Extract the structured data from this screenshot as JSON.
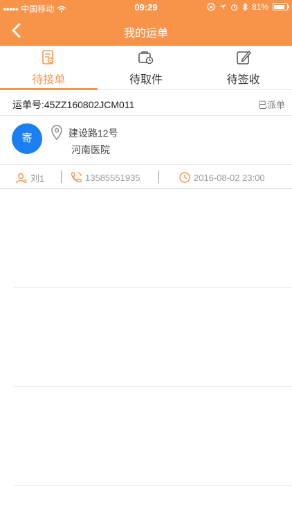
{
  "status_bar": {
    "signal_dots": "●●●●●",
    "carrier": "中国移动",
    "time": "09:29",
    "battery_percent": "81%",
    "battery_level": 0.81
  },
  "navbar": {
    "title": "我的运单"
  },
  "tabs": [
    {
      "label": "待接单",
      "active": true,
      "icon": "list-doc-icon"
    },
    {
      "label": "待取件",
      "active": false,
      "icon": "package-clock-icon"
    },
    {
      "label": "待签收",
      "active": false,
      "icon": "edit-sign-icon"
    }
  ],
  "order": {
    "number": "运单号:45ZZ160802JCM011",
    "status": "已派单"
  },
  "card": {
    "avatar_label": "寄",
    "address_line1": "建设路12号",
    "address_line2": "河南医院"
  },
  "info": {
    "name": "刘1",
    "phone": "13585551935",
    "datetime": "2016-08-02 23:00"
  },
  "colors": {
    "accent": "#f7944a",
    "avatar": "#1a7ff0"
  }
}
